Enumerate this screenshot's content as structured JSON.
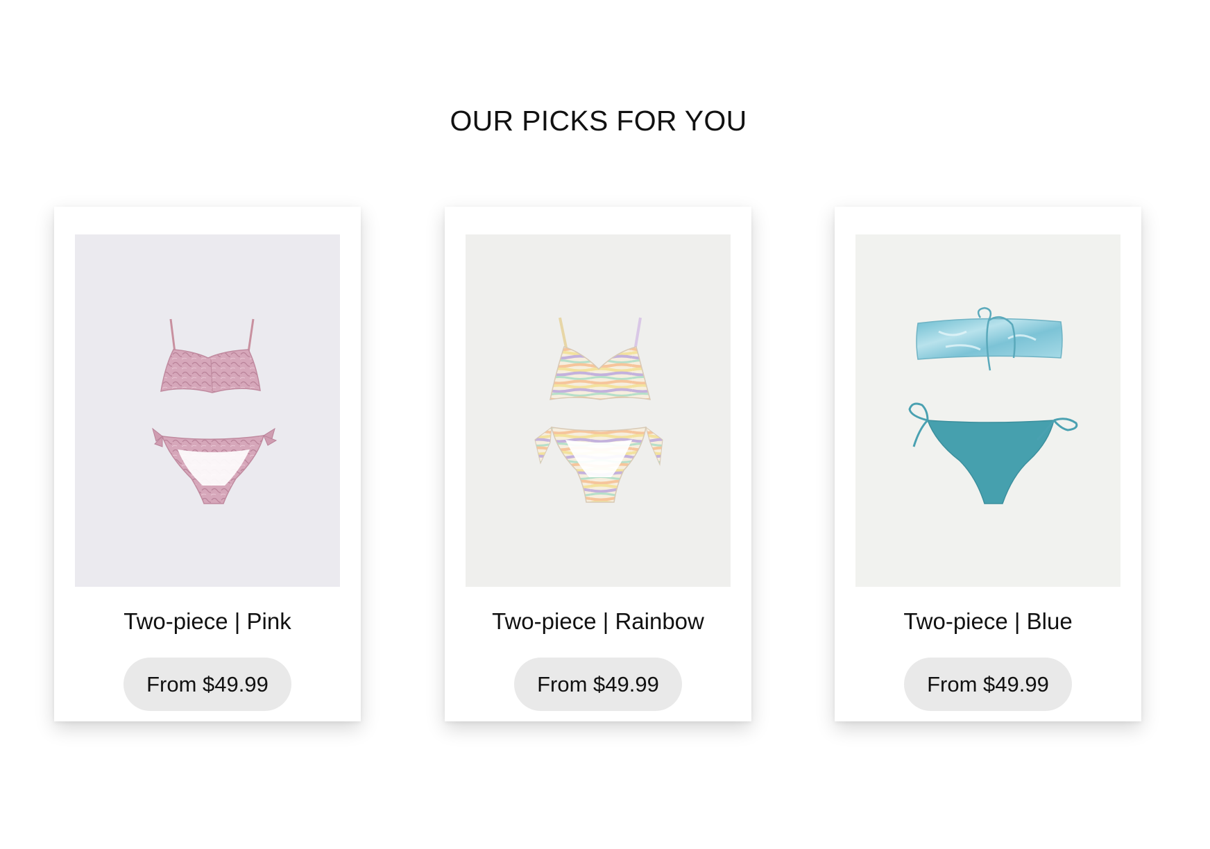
{
  "section": {
    "title": "OUR PICKS FOR YOU"
  },
  "products": [
    {
      "name": "Two-piece | Pink",
      "price_label": "From $49.99",
      "image_icon": "pink-bikini-image",
      "colors": {
        "fabric": "#d6a7ba",
        "pattern": "#b98299",
        "background": "#ebeaef"
      }
    },
    {
      "name": "Two-piece | Rainbow",
      "price_label": "From $49.99",
      "image_icon": "rainbow-bikini-image",
      "colors": {
        "stripe_1": "#f3e29e",
        "stripe_2": "#c3b1dc",
        "stripe_3": "#b5dfc9",
        "stripe_4": "#f6c59b",
        "background": "#efefed"
      }
    },
    {
      "name": "Two-piece | Blue",
      "price_label": "From $49.99",
      "image_icon": "blue-bikini-image",
      "colors": {
        "top_fabric": "#7cc3d6",
        "bottom_fabric": "#46a0ae",
        "background": "#f1f2ef"
      }
    }
  ]
}
